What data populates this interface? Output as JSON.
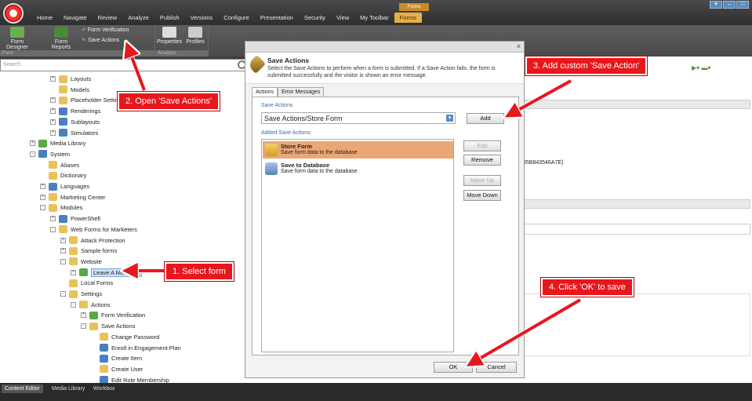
{
  "ribbon": {
    "tabs": [
      "Home",
      "Navigate",
      "Review",
      "Analyze",
      "Publish",
      "Versions",
      "Configure",
      "Presentation",
      "Security",
      "View",
      "My Toolbar",
      "Forms"
    ],
    "active_tab": "Forms",
    "context_label": "Forms",
    "buttons": {
      "form_designer": "Form Designer",
      "form_reports": "Form Reports",
      "form_verification": "Form Verification",
      "save_actions": "Save Actions",
      "properties": "Properties",
      "profiles": "Profiles"
    },
    "groups": {
      "form": "Form",
      "analytics": "Analytics"
    }
  },
  "search": {
    "placeholder": "Search"
  },
  "tree": [
    {
      "label": "Layouts",
      "indent": 2,
      "icon": "folder",
      "exp": "+"
    },
    {
      "label": "Models",
      "indent": 2,
      "icon": "folder",
      "exp": ""
    },
    {
      "label": "Placeholder Settings",
      "indent": 2,
      "icon": "folder",
      "exp": "+"
    },
    {
      "label": "Renderings",
      "indent": 2,
      "icon": "blue",
      "exp": "+"
    },
    {
      "label": "Sublayouts",
      "indent": 2,
      "icon": "blue",
      "exp": "+"
    },
    {
      "label": "Simulators",
      "indent": 2,
      "icon": "blue",
      "exp": "+"
    },
    {
      "label": "Media Library",
      "indent": 0,
      "icon": "green",
      "exp": "+"
    },
    {
      "label": "System",
      "indent": 0,
      "icon": "blue",
      "exp": "-"
    },
    {
      "label": "Aliases",
      "indent": 1,
      "icon": "folder",
      "exp": ""
    },
    {
      "label": "Dictionary",
      "indent": 1,
      "icon": "folder",
      "exp": ""
    },
    {
      "label": "Languages",
      "indent": 1,
      "icon": "blue",
      "exp": "+"
    },
    {
      "label": "Marketing Center",
      "indent": 1,
      "icon": "folder",
      "exp": "+"
    },
    {
      "label": "Modules",
      "indent": 1,
      "icon": "folder",
      "exp": "-"
    },
    {
      "label": "PowerShell",
      "indent": 2,
      "icon": "blue",
      "exp": "+"
    },
    {
      "label": "Web Forms for Marketers",
      "indent": 2,
      "icon": "folder",
      "exp": "-"
    },
    {
      "label": "Attack Protection",
      "indent": 3,
      "icon": "folder",
      "exp": "+"
    },
    {
      "label": "Sample forms",
      "indent": 3,
      "icon": "folder",
      "exp": "+"
    },
    {
      "label": "Website",
      "indent": 3,
      "icon": "folder",
      "exp": "-"
    },
    {
      "label": "Leave A Message",
      "indent": 4,
      "icon": "green",
      "exp": "+",
      "selected": true
    },
    {
      "label": "Local Forms",
      "indent": 3,
      "icon": "folder",
      "exp": ""
    },
    {
      "label": "Settings",
      "indent": 3,
      "icon": "folder",
      "exp": "-"
    },
    {
      "label": "Actions",
      "indent": 4,
      "icon": "folder",
      "exp": "-"
    },
    {
      "label": "Form Verification",
      "indent": 5,
      "icon": "green",
      "exp": "+"
    },
    {
      "label": "Save Actions",
      "indent": 5,
      "icon": "folder",
      "exp": "-"
    },
    {
      "label": "Change Password",
      "indent": 6,
      "icon": "folder",
      "exp": ""
    },
    {
      "label": "Enroll in Engagement Plan",
      "indent": 6,
      "icon": "blue",
      "exp": ""
    },
    {
      "label": "Create Item",
      "indent": 6,
      "icon": "blue",
      "exp": ""
    },
    {
      "label": "Create User",
      "indent": 6,
      "icon": "folder",
      "exp": ""
    },
    {
      "label": "Edit Role Membership",
      "indent": 6,
      "icon": "blue",
      "exp": ""
    }
  ],
  "dialog": {
    "title": "Save Actions",
    "description": "Select the Save Actions to perform when a form is submitted. If a Save Action fails, the form is submitted successfully and the visitor is shown an error message.",
    "tabs": [
      "Actions",
      "Error Messages"
    ],
    "save_actions_label": "Save Actions",
    "select_value": "Save Actions/Store Form",
    "add_label": "Add",
    "added_label": "Added Save Actions:",
    "items": [
      {
        "title": "Store Form",
        "desc": "Save form data to the database"
      },
      {
        "title": "Save to Database",
        "desc": "Save form data to the database"
      }
    ],
    "side_buttons": {
      "edit": "Edit",
      "remove": "Remove",
      "move_up": "Move Up",
      "move_down": "Move Down"
    },
    "ok": "OK",
    "cancel": "Cancel",
    "close": "×"
  },
  "right_panel": {
    "guid_fragment": "95B843546A7E}"
  },
  "annotations": {
    "a1": "1. Select form",
    "a2": "2. Open 'Save Actions'",
    "a3": "3. Add custom 'Save Action'",
    "a4": "4. Click 'OK' to save"
  },
  "bottom_tabs": [
    "Content Editor",
    "Media Library",
    "Workbox"
  ],
  "colors": {
    "annotation_red": "#e8171d",
    "selected_item": "#eaa774",
    "accent_orange": "#e8b04a"
  }
}
